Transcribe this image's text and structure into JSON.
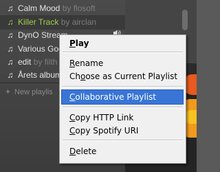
{
  "sidebar": {
    "playlists": [
      {
        "name": "Calm Mood",
        "by": "by flosoft",
        "active": false
      },
      {
        "name": "Killer Track",
        "by": "by airclan",
        "active": true
      },
      {
        "name": "DynO Stream",
        "by": "",
        "active": false
      },
      {
        "name": "Various Goo",
        "by": "",
        "active": false
      },
      {
        "name": "edit",
        "by": "by filth",
        "active": false
      },
      {
        "name": "Årets album",
        "by": "",
        "active": false
      }
    ],
    "new_playlist_label": "New playlis"
  },
  "context_menu": {
    "items": [
      {
        "label": "Play",
        "underline": "P",
        "rest": "lay"
      },
      {
        "label": "Rename",
        "underline": "R",
        "rest": "ename"
      },
      {
        "label": "Choose as Current Playlist",
        "pre": "Ch",
        "underline": "o",
        "rest": "ose as Current Playlist"
      },
      {
        "label": "Collaborative Playlist",
        "underline": "C",
        "rest": "ollaborative Playlist"
      },
      {
        "label": "Copy HTTP Link",
        "underline": "C",
        "rest": "opy HTTP Link"
      },
      {
        "label": "Copy Spotify URI",
        "underline": "C",
        "rest": "opy Spotify URI"
      },
      {
        "label": "Delete",
        "underline": "D",
        "rest": "elete"
      }
    ]
  },
  "colors": {
    "active_playlist": "#9fcf4f",
    "menu_highlight": "#3875d7"
  }
}
